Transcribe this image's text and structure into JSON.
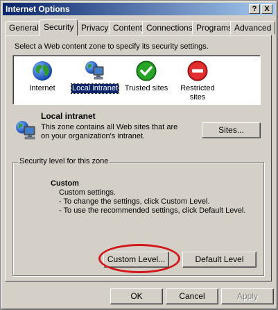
{
  "window": {
    "title": "Internet Options",
    "help_label": "?",
    "close_label": "X"
  },
  "tabs": [
    {
      "label": "General"
    },
    {
      "label": "Security",
      "active": true
    },
    {
      "label": "Privacy"
    },
    {
      "label": "Content"
    },
    {
      "label": "Connections"
    },
    {
      "label": "Programs"
    },
    {
      "label": "Advanced"
    }
  ],
  "security": {
    "instruction": "Select a Web content zone to specify its security settings.",
    "zones": [
      {
        "label": "Internet",
        "icon": "globe-icon"
      },
      {
        "label": "Local intranet",
        "icon": "intranet-computer-icon",
        "selected": true
      },
      {
        "label": "Trusted sites",
        "icon": "check-icon"
      },
      {
        "label": "Restricted sites",
        "icon": "no-entry-icon"
      }
    ],
    "selected_zone": {
      "title": "Local intranet",
      "description": "This zone contains all Web sites that are on your organization's intranet.",
      "sites_button": "Sites..."
    },
    "level_group_label": "Security level for this zone",
    "level": {
      "title": "Custom",
      "lines": [
        "Custom settings.",
        "- To change the settings, click Custom Level.",
        "- To use the recommended settings, click Default Level."
      ],
      "custom_button": "Custom Level...",
      "default_button": "Default Level"
    }
  },
  "footer": {
    "ok": "OK",
    "cancel": "Cancel",
    "apply": "Apply"
  },
  "colors": {
    "titlebar": "#0a246a",
    "dialog_bg": "#d4d0c8",
    "highlight_ring": "#d21818",
    "selection": "#0a246a"
  }
}
